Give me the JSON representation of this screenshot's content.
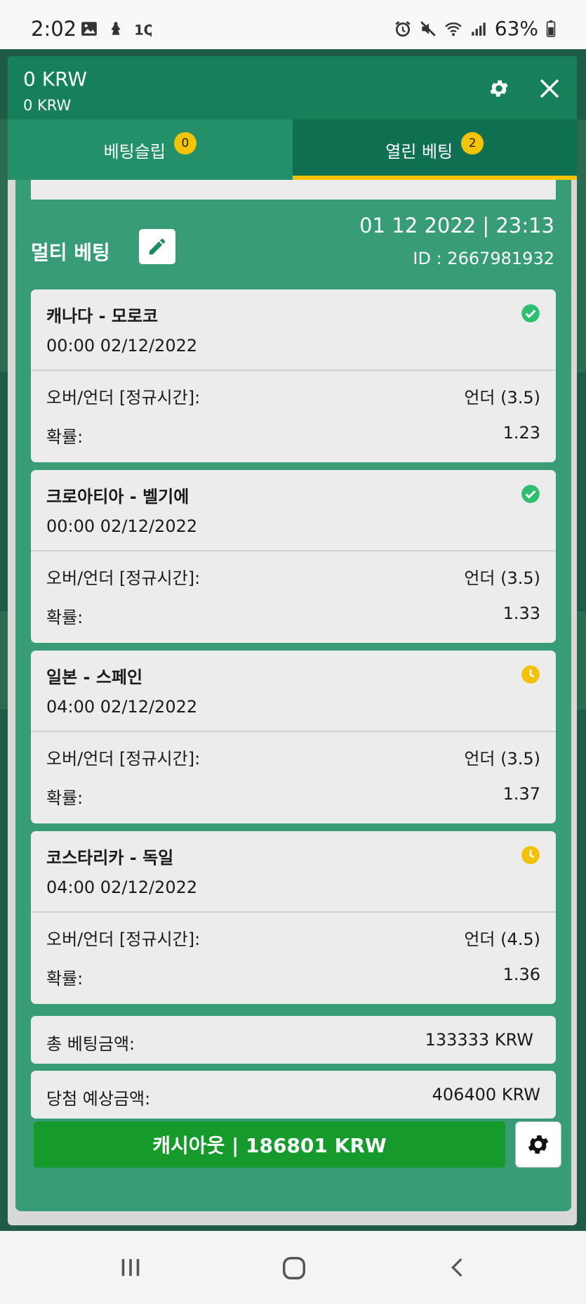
{
  "status_bar": {
    "time": "2:02",
    "battery": "63%"
  },
  "header": {
    "balance": "0 KRW",
    "balance_sub": "0 KRW"
  },
  "tabs": [
    {
      "label": "베팅슬립",
      "badge": "0",
      "active": false
    },
    {
      "label": "열린 베팅",
      "badge": "2",
      "active": true
    }
  ],
  "bet": {
    "title": "멀티 베팅",
    "datetime": "01 12 2022 | 23:13",
    "id": "ID :  2667981932",
    "selections": [
      {
        "match": "캐나다 - 모로코",
        "kickoff": "00:00   02/12/2022",
        "market_label": "오버/언더 [정규시간]:",
        "market_value": "언더 (3.5)",
        "odds_label": "확률:",
        "odds": "1.23",
        "status": "won"
      },
      {
        "match": "크로아티아 - 벨기에",
        "kickoff": "00:00   02/12/2022",
        "market_label": "오버/언더 [정규시간]:",
        "market_value": "언더 (3.5)",
        "odds_label": "확률:",
        "odds": "1.33",
        "status": "won"
      },
      {
        "match": "일본 - 스페인",
        "kickoff": "04:00   02/12/2022",
        "market_label": "오버/언더 [정규시간]:",
        "market_value": "언더 (3.5)",
        "odds_label": "확률:",
        "odds": "1.37",
        "status": "pending"
      },
      {
        "match": "코스타리카 - 독일",
        "kickoff": "04:00   02/12/2022",
        "market_label": "오버/언더 [정규시간]:",
        "market_value": "언더 (4.5)",
        "odds_label": "확률:",
        "odds": "1.36",
        "status": "pending"
      }
    ],
    "total_stake_label": "총 베팅금액:",
    "total_stake": "133333 KRW",
    "potential_win_label": "당첨 예상금액:",
    "potential_win": "406400 KRW",
    "cashout_label": "캐시아웃 | 186801 KRW"
  },
  "colors": {
    "primary": "#15805a",
    "card": "#389c77",
    "accent": "#f5c400",
    "won": "#2fbf71",
    "pending": "#f2c200",
    "cashout": "#159a2b"
  }
}
